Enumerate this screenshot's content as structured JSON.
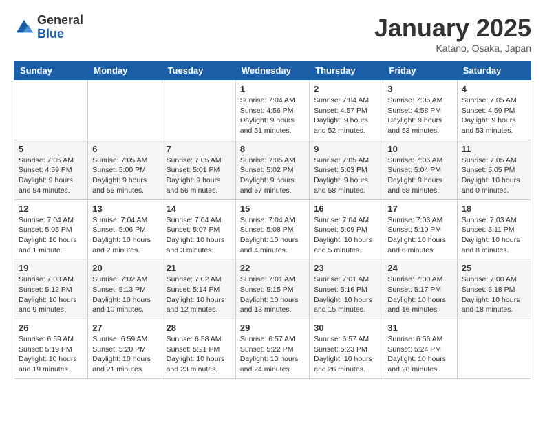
{
  "header": {
    "logo": {
      "general": "General",
      "blue": "Blue"
    },
    "title": "January 2025",
    "location": "Katano, Osaka, Japan"
  },
  "weekdays": [
    "Sunday",
    "Monday",
    "Tuesday",
    "Wednesday",
    "Thursday",
    "Friday",
    "Saturday"
  ],
  "weeks": [
    [
      {
        "day": "",
        "info": ""
      },
      {
        "day": "",
        "info": ""
      },
      {
        "day": "",
        "info": ""
      },
      {
        "day": "1",
        "info": "Sunrise: 7:04 AM\nSunset: 4:56 PM\nDaylight: 9 hours\nand 51 minutes."
      },
      {
        "day": "2",
        "info": "Sunrise: 7:04 AM\nSunset: 4:57 PM\nDaylight: 9 hours\nand 52 minutes."
      },
      {
        "day": "3",
        "info": "Sunrise: 7:05 AM\nSunset: 4:58 PM\nDaylight: 9 hours\nand 53 minutes."
      },
      {
        "day": "4",
        "info": "Sunrise: 7:05 AM\nSunset: 4:59 PM\nDaylight: 9 hours\nand 53 minutes."
      }
    ],
    [
      {
        "day": "5",
        "info": "Sunrise: 7:05 AM\nSunset: 4:59 PM\nDaylight: 9 hours\nand 54 minutes."
      },
      {
        "day": "6",
        "info": "Sunrise: 7:05 AM\nSunset: 5:00 PM\nDaylight: 9 hours\nand 55 minutes."
      },
      {
        "day": "7",
        "info": "Sunrise: 7:05 AM\nSunset: 5:01 PM\nDaylight: 9 hours\nand 56 minutes."
      },
      {
        "day": "8",
        "info": "Sunrise: 7:05 AM\nSunset: 5:02 PM\nDaylight: 9 hours\nand 57 minutes."
      },
      {
        "day": "9",
        "info": "Sunrise: 7:05 AM\nSunset: 5:03 PM\nDaylight: 9 hours\nand 58 minutes."
      },
      {
        "day": "10",
        "info": "Sunrise: 7:05 AM\nSunset: 5:04 PM\nDaylight: 9 hours\nand 58 minutes."
      },
      {
        "day": "11",
        "info": "Sunrise: 7:05 AM\nSunset: 5:05 PM\nDaylight: 10 hours\nand 0 minutes."
      }
    ],
    [
      {
        "day": "12",
        "info": "Sunrise: 7:04 AM\nSunset: 5:05 PM\nDaylight: 10 hours\nand 1 minute."
      },
      {
        "day": "13",
        "info": "Sunrise: 7:04 AM\nSunset: 5:06 PM\nDaylight: 10 hours\nand 2 minutes."
      },
      {
        "day": "14",
        "info": "Sunrise: 7:04 AM\nSunset: 5:07 PM\nDaylight: 10 hours\nand 3 minutes."
      },
      {
        "day": "15",
        "info": "Sunrise: 7:04 AM\nSunset: 5:08 PM\nDaylight: 10 hours\nand 4 minutes."
      },
      {
        "day": "16",
        "info": "Sunrise: 7:04 AM\nSunset: 5:09 PM\nDaylight: 10 hours\nand 5 minutes."
      },
      {
        "day": "17",
        "info": "Sunrise: 7:03 AM\nSunset: 5:10 PM\nDaylight: 10 hours\nand 6 minutes."
      },
      {
        "day": "18",
        "info": "Sunrise: 7:03 AM\nSunset: 5:11 PM\nDaylight: 10 hours\nand 8 minutes."
      }
    ],
    [
      {
        "day": "19",
        "info": "Sunrise: 7:03 AM\nSunset: 5:12 PM\nDaylight: 10 hours\nand 9 minutes."
      },
      {
        "day": "20",
        "info": "Sunrise: 7:02 AM\nSunset: 5:13 PM\nDaylight: 10 hours\nand 10 minutes."
      },
      {
        "day": "21",
        "info": "Sunrise: 7:02 AM\nSunset: 5:14 PM\nDaylight: 10 hours\nand 12 minutes."
      },
      {
        "day": "22",
        "info": "Sunrise: 7:01 AM\nSunset: 5:15 PM\nDaylight: 10 hours\nand 13 minutes."
      },
      {
        "day": "23",
        "info": "Sunrise: 7:01 AM\nSunset: 5:16 PM\nDaylight: 10 hours\nand 15 minutes."
      },
      {
        "day": "24",
        "info": "Sunrise: 7:00 AM\nSunset: 5:17 PM\nDaylight: 10 hours\nand 16 minutes."
      },
      {
        "day": "25",
        "info": "Sunrise: 7:00 AM\nSunset: 5:18 PM\nDaylight: 10 hours\nand 18 minutes."
      }
    ],
    [
      {
        "day": "26",
        "info": "Sunrise: 6:59 AM\nSunset: 5:19 PM\nDaylight: 10 hours\nand 19 minutes."
      },
      {
        "day": "27",
        "info": "Sunrise: 6:59 AM\nSunset: 5:20 PM\nDaylight: 10 hours\nand 21 minutes."
      },
      {
        "day": "28",
        "info": "Sunrise: 6:58 AM\nSunset: 5:21 PM\nDaylight: 10 hours\nand 23 minutes."
      },
      {
        "day": "29",
        "info": "Sunrise: 6:57 AM\nSunset: 5:22 PM\nDaylight: 10 hours\nand 24 minutes."
      },
      {
        "day": "30",
        "info": "Sunrise: 6:57 AM\nSunset: 5:23 PM\nDaylight: 10 hours\nand 26 minutes."
      },
      {
        "day": "31",
        "info": "Sunrise: 6:56 AM\nSunset: 5:24 PM\nDaylight: 10 hours\nand 28 minutes."
      },
      {
        "day": "",
        "info": ""
      }
    ]
  ]
}
